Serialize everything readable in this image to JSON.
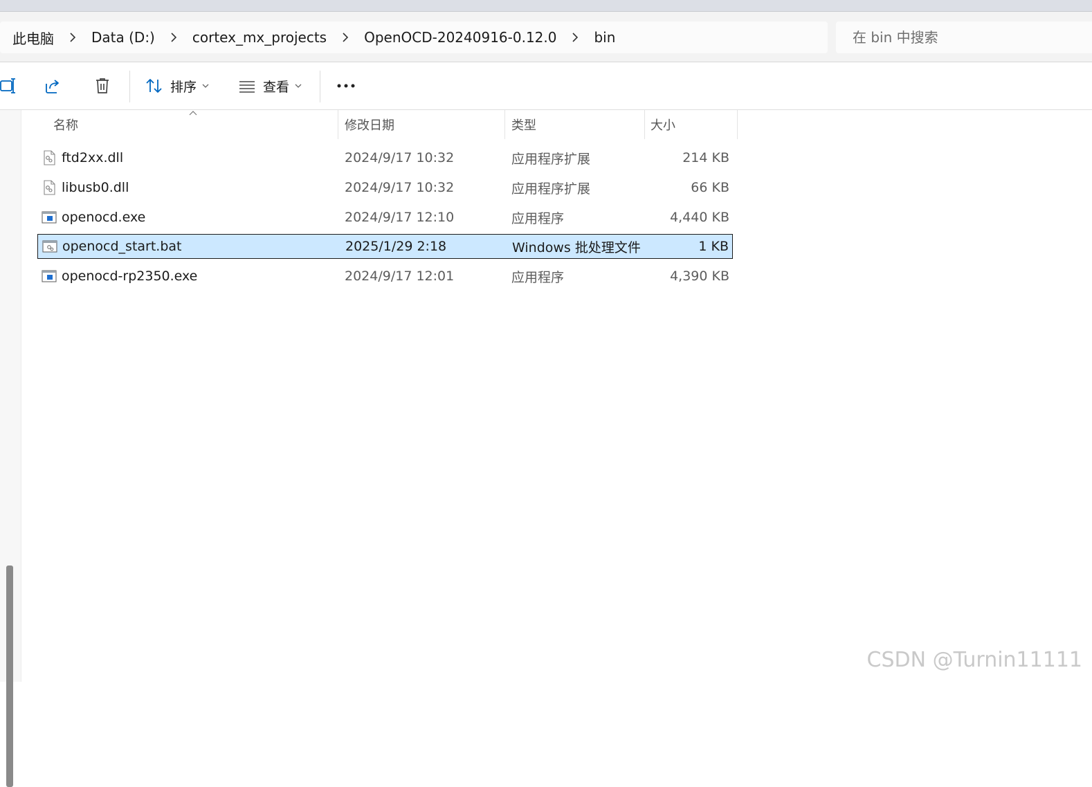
{
  "breadcrumb": [
    "此电脑",
    "Data (D:)",
    "cortex_mx_projects",
    "OpenOCD-20240916-0.12.0",
    "bin"
  ],
  "search": {
    "placeholder": "在 bin 中搜索"
  },
  "toolbar": {
    "sort_label": "排序",
    "view_label": "查看"
  },
  "columns": {
    "name": "名称",
    "date": "修改日期",
    "type": "类型",
    "size": "大小"
  },
  "files": [
    {
      "name": "ftd2xx.dll",
      "date": "2024/9/17 10:32",
      "type": "应用程序扩展",
      "size": "214 KB",
      "icon": "dll-file-icon",
      "selected": false
    },
    {
      "name": "libusb0.dll",
      "date": "2024/9/17 10:32",
      "type": "应用程序扩展",
      "size": "66 KB",
      "icon": "dll-file-icon",
      "selected": false
    },
    {
      "name": "openocd.exe",
      "date": "2024/9/17 12:10",
      "type": "应用程序",
      "size": "4,440 KB",
      "icon": "exe-file-icon",
      "selected": false
    },
    {
      "name": "openocd_start.bat",
      "date": "2025/1/29 2:18",
      "type": "Windows 批处理文件",
      "size": "1 KB",
      "icon": "bat-file-icon",
      "selected": true
    },
    {
      "name": "openocd-rp2350.exe",
      "date": "2024/9/17 12:01",
      "type": "应用程序",
      "size": "4,390 KB",
      "icon": "exe-file-icon",
      "selected": false
    }
  ],
  "watermark": "CSDN @Turnin11111",
  "colors": {
    "selection": "#cce8ff",
    "accent": "#0067c0"
  }
}
